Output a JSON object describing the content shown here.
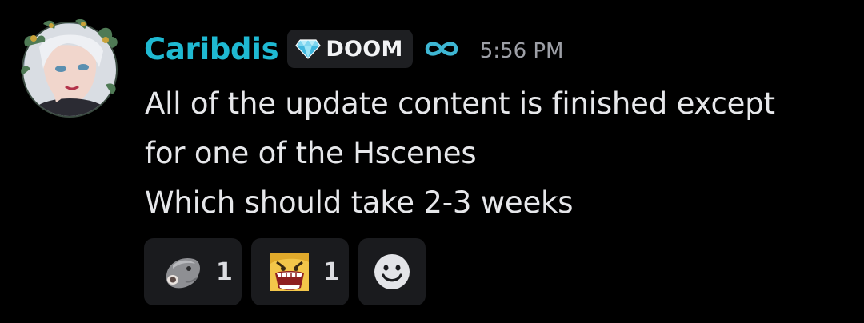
{
  "message": {
    "author": {
      "username": "Caribdis",
      "username_color": "#1fb9d2",
      "clan_tag": {
        "icon": "diamond-icon",
        "text": "DOOM"
      },
      "badge_icon": "infinity-icon"
    },
    "timestamp": "5:56 PM",
    "lines": [
      "All of the update content is finished except",
      "for one of the Hscenes",
      "Which should take 2-3 weeks"
    ]
  },
  "reactions": [
    {
      "emoji": "fish-face-emoji",
      "count": "1"
    },
    {
      "emoji": "screaming-face-emoji",
      "count": "1"
    }
  ],
  "add_reaction": {
    "icon": "smiley-add-reaction-icon"
  }
}
